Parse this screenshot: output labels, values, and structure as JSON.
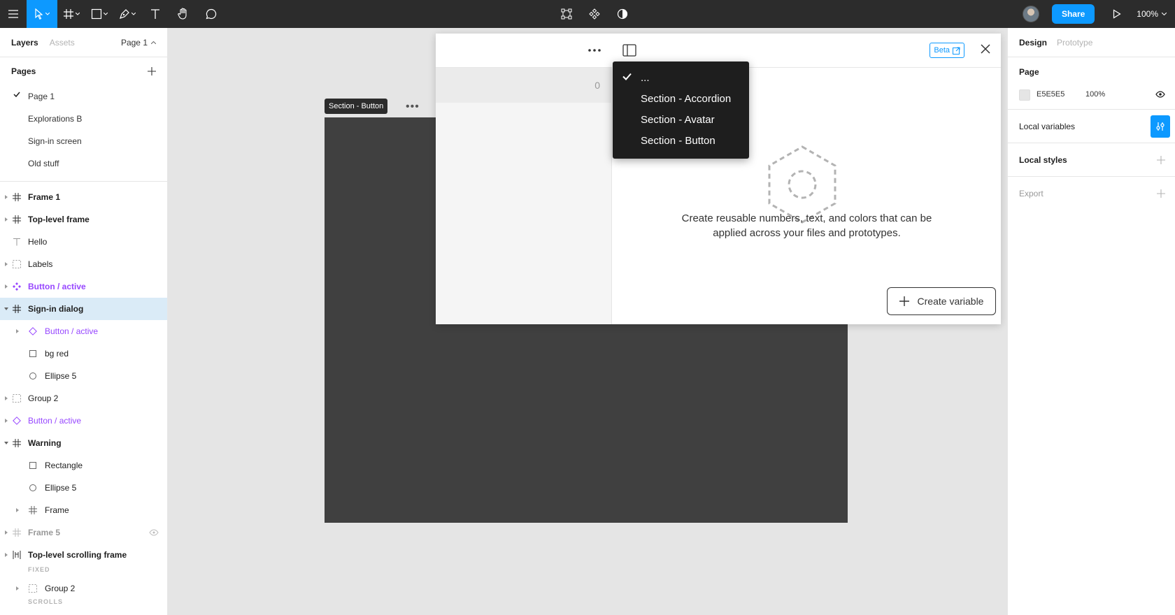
{
  "toolbar": {
    "share_label": "Share",
    "zoom_label": "100%"
  },
  "left_panel": {
    "tabs": [
      "Layers",
      "Assets"
    ],
    "page_selector": "Page 1",
    "pages_title": "Pages",
    "pages": [
      "Page 1",
      "Explorations B",
      "Sign-in screen",
      "Old stuff"
    ],
    "layers": [
      {
        "name": "Frame 1"
      },
      {
        "name": "Top-level frame"
      },
      {
        "name": "Hello"
      },
      {
        "name": "Labels"
      },
      {
        "name": "Button / active"
      },
      {
        "name": "Sign-in dialog"
      },
      {
        "name": "Button / active"
      },
      {
        "name": "bg red"
      },
      {
        "name": "Ellipse 5"
      },
      {
        "name": "Group 2"
      },
      {
        "name": "Button / active"
      },
      {
        "name": "Warning"
      },
      {
        "name": "Rectangle"
      },
      {
        "name": "Ellipse 5"
      },
      {
        "name": "Frame"
      },
      {
        "name": "Frame 5"
      },
      {
        "name": "Top-level scrolling frame"
      },
      {
        "name": "Group 2"
      }
    ],
    "captions": {
      "fixed": "FIXED",
      "scrolls": "SCROLLS"
    }
  },
  "canvas": {
    "section_label": "Section - Button",
    "section_more": "•••"
  },
  "variables_modal": {
    "count": "0",
    "beta_label": "Beta",
    "empty_message_line1": "Create reusable numbers, text, and colors that can be",
    "empty_message_line2": "applied across your files and prototypes.",
    "create_button": "Create variable"
  },
  "dropdown": {
    "items": [
      "...",
      "Section - Accordion",
      "Section - Avatar",
      "Section - Button"
    ],
    "checked_index": 0
  },
  "right_panel": {
    "tabs": [
      "Design",
      "Prototype"
    ],
    "page_title": "Page",
    "page_color_hex": "E5E5E5",
    "page_color_opacity": "100%",
    "local_variables": "Local variables",
    "local_styles": "Local styles",
    "export": "Export"
  },
  "colors": {
    "accent": "#0d99ff",
    "component": "#9747ff",
    "toolbar_bg": "#2c2c2c",
    "canvas_bg": "#e5e5e5",
    "frame_dark": "#404040"
  }
}
